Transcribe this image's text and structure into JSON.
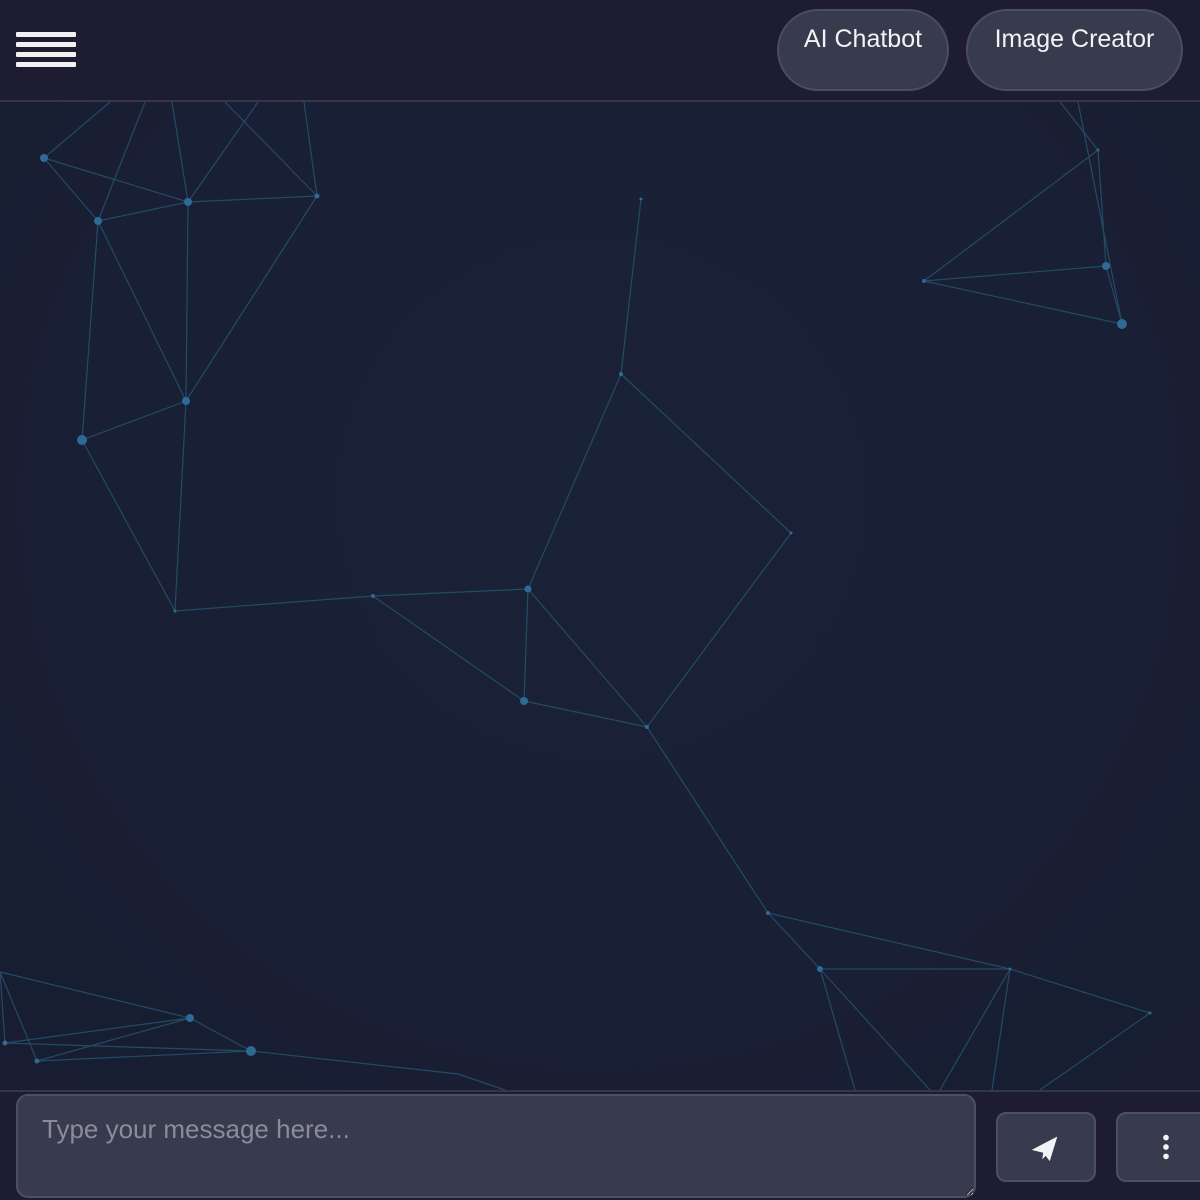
{
  "header": {
    "menu_icon": "hamburger-menu-icon",
    "nav": [
      {
        "label": "AI Chatbot"
      },
      {
        "label": "Image Creator"
      }
    ]
  },
  "composer": {
    "placeholder": "Type your message here...",
    "send_icon": "paper-plane-icon",
    "more_icon": "vertical-ellipsis-icon"
  },
  "colors": {
    "bar_bg": "#1d1c30",
    "canvas_bg": "#1a1f35",
    "control_bg": "#383a4d",
    "node": "#2f6a94",
    "edge": "#24536e",
    "text": "#f3f3f6"
  }
}
